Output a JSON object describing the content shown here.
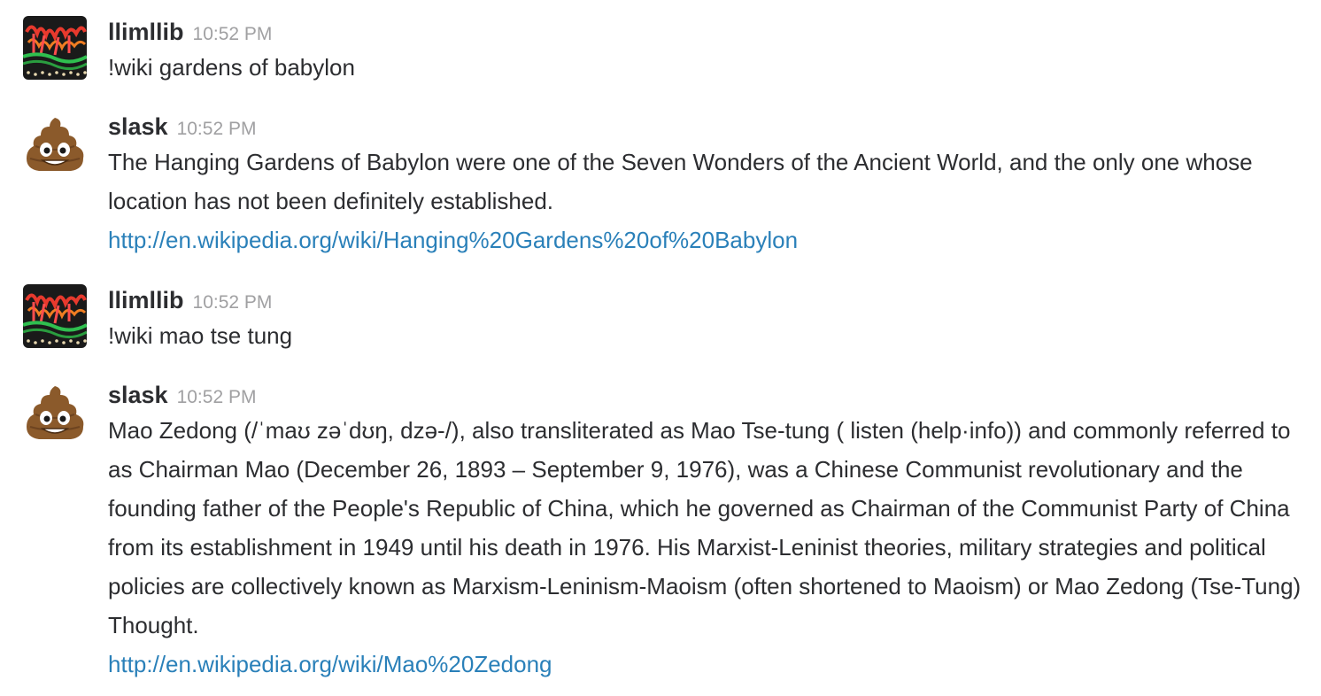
{
  "messages": [
    {
      "user": "llimllib",
      "time": "10:52 PM",
      "avatar_icon": "neon-sign-avatar",
      "text": "!wiki gardens of babylon",
      "link": ""
    },
    {
      "user": "slask",
      "time": "10:52 PM",
      "avatar_icon": "poop-emoji-avatar",
      "text": "The Hanging Gardens of Babylon were one of the Seven Wonders of the Ancient World, and the only one whose location has not been definitely established.",
      "link": "http://en.wikipedia.org/wiki/Hanging%20Gardens%20of%20Babylon"
    },
    {
      "user": "llimllib",
      "time": "10:52 PM",
      "avatar_icon": "neon-sign-avatar",
      "text": "!wiki mao tse tung",
      "link": ""
    },
    {
      "user": "slask",
      "time": "10:52 PM",
      "avatar_icon": "poop-emoji-avatar",
      "text": "Mao Zedong (/ˈmaʊ zəˈdʊŋ, dzə-/), also transliterated as Mao Tse-tung ( listen (help·info)) and commonly referred to as Chairman Mao (December 26, 1893 – September 9, 1976), was a Chinese Communist revolutionary and the founding father of the People's Republic of China, which he governed as Chairman of the Communist Party of China from its establishment in 1949 until his death in 1976. His Marxist-Leninist theories, military strategies and political policies are collectively known as Marxism-Leninism-Maoism (often shortened to Maoism) or Mao Zedong (Tse-Tung) Thought.",
      "link": "http://en.wikipedia.org/wiki/Mao%20Zedong"
    }
  ],
  "colors": {
    "username": "#2c2d30",
    "timestamp": "#a0a0a2",
    "body": "#2c2d30",
    "link": "#2a80b9"
  }
}
